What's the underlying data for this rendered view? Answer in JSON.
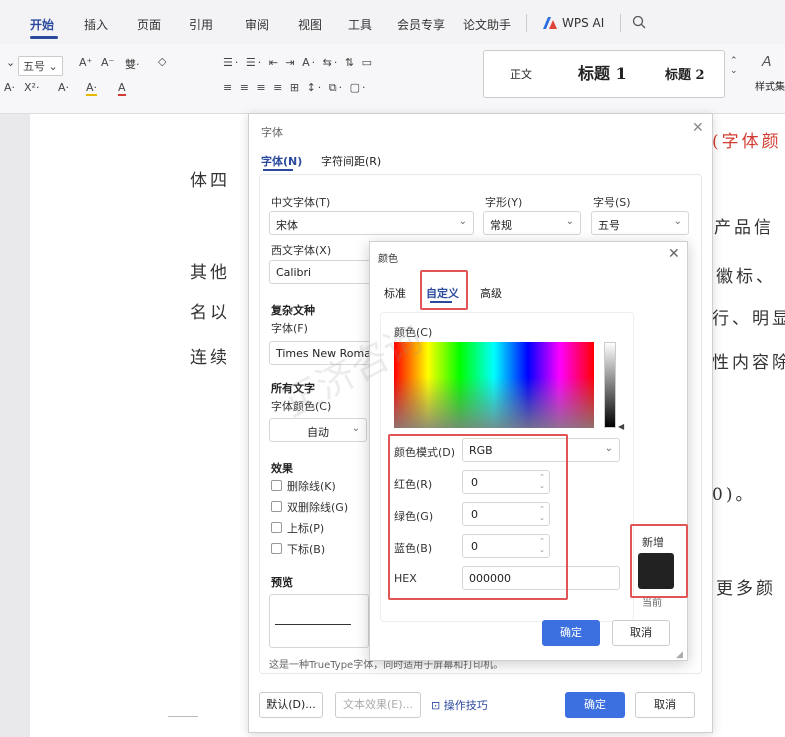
{
  "ribbon": {
    "tabs": [
      "开始",
      "插入",
      "页面",
      "引用",
      "审阅",
      "视图",
      "工具",
      "会员专享",
      "论文助手",
      "WPS AI"
    ],
    "active_tab": "开始"
  },
  "toolbar": {
    "font_size": "五号",
    "row1_items": [
      "A⁺",
      "A⁻",
      "雙·",
      "◇"
    ],
    "row2_items": [
      "A·",
      "X²·",
      "A·",
      "A·",
      "A"
    ],
    "styles": {
      "normal": "正文",
      "heading1": "标题 1",
      "heading2": "标题 2",
      "more": "样式集"
    }
  },
  "document": {
    "lines": [
      "体四",
      "其他",
      "名以",
      "连续",
      "(字体颜",
      "产品信",
      "徽标、",
      "行、明显",
      "性内容除",
      "0)。",
      "更多颜"
    ]
  },
  "font_dialog": {
    "title": "字体",
    "tabs": [
      "字体(N)",
      "字符间距(R)"
    ],
    "chinese_font_label": "中文字体(T)",
    "chinese_font_value": "宋体",
    "style_label": "字形(Y)",
    "style_value": "常规",
    "size_label": "字号(S)",
    "size_value": "五号",
    "western_font_label": "西文字体(X)",
    "western_font_value": "Calibri",
    "complex_section": "复杂文种",
    "complex_font_label": "字体(F)",
    "complex_font_value": "Times New Roman",
    "all_text_section": "所有文字",
    "font_color_label": "字体颜色(C)",
    "font_color_value": "自动",
    "effects_section": "效果",
    "effects": [
      "删除线(K)",
      "双删除线(G)",
      "上标(P)",
      "下标(B)"
    ],
    "preview_section": "预览",
    "note": "这是一种TrueType字体，同时适用于屏幕和打印机。",
    "buttons": {
      "default": "默认(D)...",
      "text_effects": "文本效果(E)...",
      "tips": "操作技巧",
      "ok": "确定",
      "cancel": "取消"
    }
  },
  "color_dialog": {
    "title": "颜色",
    "tabs": [
      "标准",
      "自定义",
      "高级"
    ],
    "active_tab": "自定义",
    "color_label": "颜色(C)",
    "mode_label": "颜色模式(D)",
    "mode_value": "RGB",
    "red_label": "红色(R)",
    "red_value": "0",
    "green_label": "绿色(G)",
    "green_value": "0",
    "blue_label": "蓝色(B)",
    "blue_value": "0",
    "hex_label": "HEX",
    "hex_value": "000000",
    "new_label": "新增",
    "current_label": "当前",
    "ok": "确定",
    "cancel": "取消",
    "swatch_color": "#222222"
  },
  "watermark": "正济咨询",
  "colors": {
    "accent": "#2b4a9e",
    "primary_button": "#3c6fe0",
    "highlight_box": "#e05555",
    "doc_red": "#d23b30"
  }
}
